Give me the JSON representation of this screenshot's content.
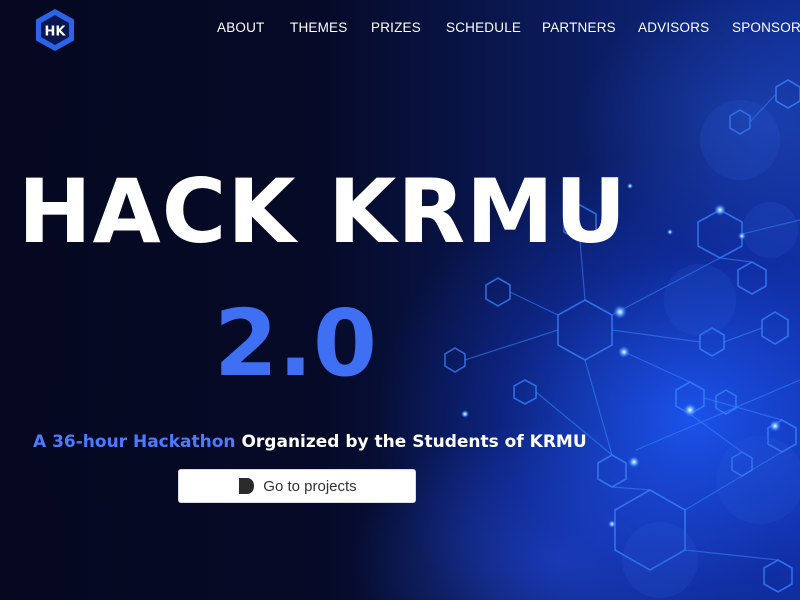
{
  "colors": {
    "background": "#05081f",
    "accent": "#3f6ff2",
    "tagline_accent": "#4b7bff",
    "network": "#2f7bff"
  },
  "logo": {
    "icon": "hexagon-logo-icon",
    "text": "HK"
  },
  "nav": {
    "items": [
      {
        "label": "ABOUT"
      },
      {
        "label": "THEMES"
      },
      {
        "label": "PRIZES"
      },
      {
        "label": "SCHEDULE"
      },
      {
        "label": "PARTNERS"
      },
      {
        "label": "ADVISORS"
      },
      {
        "label": "SPONSORS"
      }
    ]
  },
  "hero": {
    "title": "HACK KRMU",
    "version": "2.0",
    "tagline_accent": "A 36-hour Hackathon",
    "tagline_rest": " Organized by the Students of KRMU"
  },
  "cta": {
    "label": "Go to projects",
    "icon": "devpost-icon"
  }
}
